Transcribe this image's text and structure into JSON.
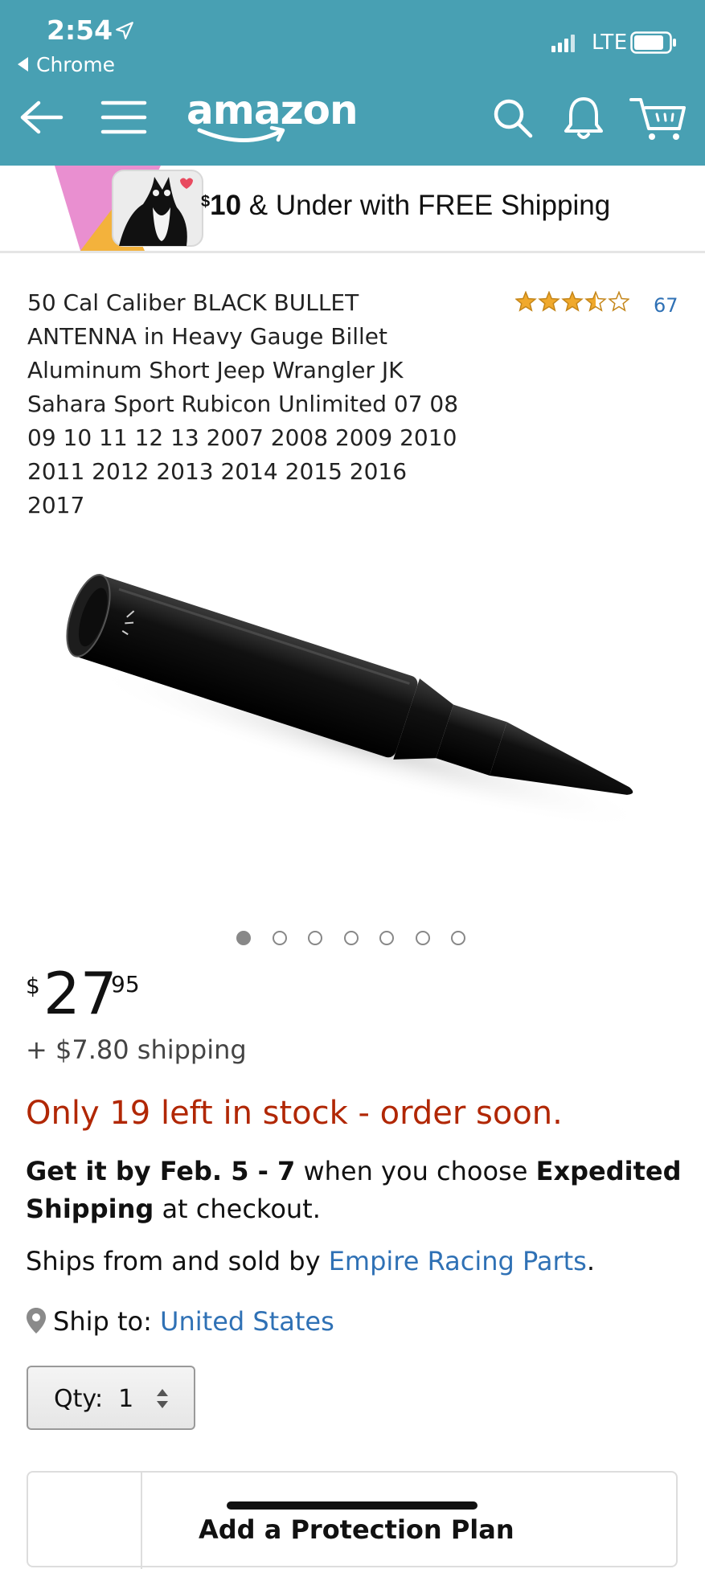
{
  "status_bar": {
    "time": "2:54",
    "back_app": "Chrome",
    "network": "LTE"
  },
  "header": {
    "logo_text": "amazon",
    "colors": {
      "background": "#48a0b3"
    }
  },
  "banner": {
    "currency": "$",
    "amount": "10",
    "text": " & Under with FREE Shipping"
  },
  "product": {
    "title": "50 Cal Caliber BLACK BULLET ANTENNA in Heavy Gauge Billet Aluminum Short Jeep Wrangler JK Sahara Sport Rubicon Unlimited 07 08 09 10 11 12 13 2007 2008 2009 2010 2011 2012 2013 2014 2015 2016 2017",
    "rating": 3.5,
    "review_count": "67",
    "image_count": 7,
    "active_image": 1,
    "price": {
      "currency": "$",
      "whole": "27",
      "fraction": "95"
    },
    "shipping": "+ $7.80 shipping",
    "stock": "Only 19 left in stock - order soon."
  },
  "delivery": {
    "date_bold": "Get it by Feb. 5 - 7",
    "mid": " when you choose ",
    "method_bold": "Expedited Shipping",
    "end": " at checkout."
  },
  "seller": {
    "prefix": "Ships from and sold by ",
    "name": "Empire Racing Parts",
    "suffix": "."
  },
  "ship_to": {
    "label": "Ship to: ",
    "country": "United States"
  },
  "quantity": {
    "label": "Qty:",
    "value": "1"
  },
  "protection": {
    "label": "Add a Protection Plan"
  }
}
